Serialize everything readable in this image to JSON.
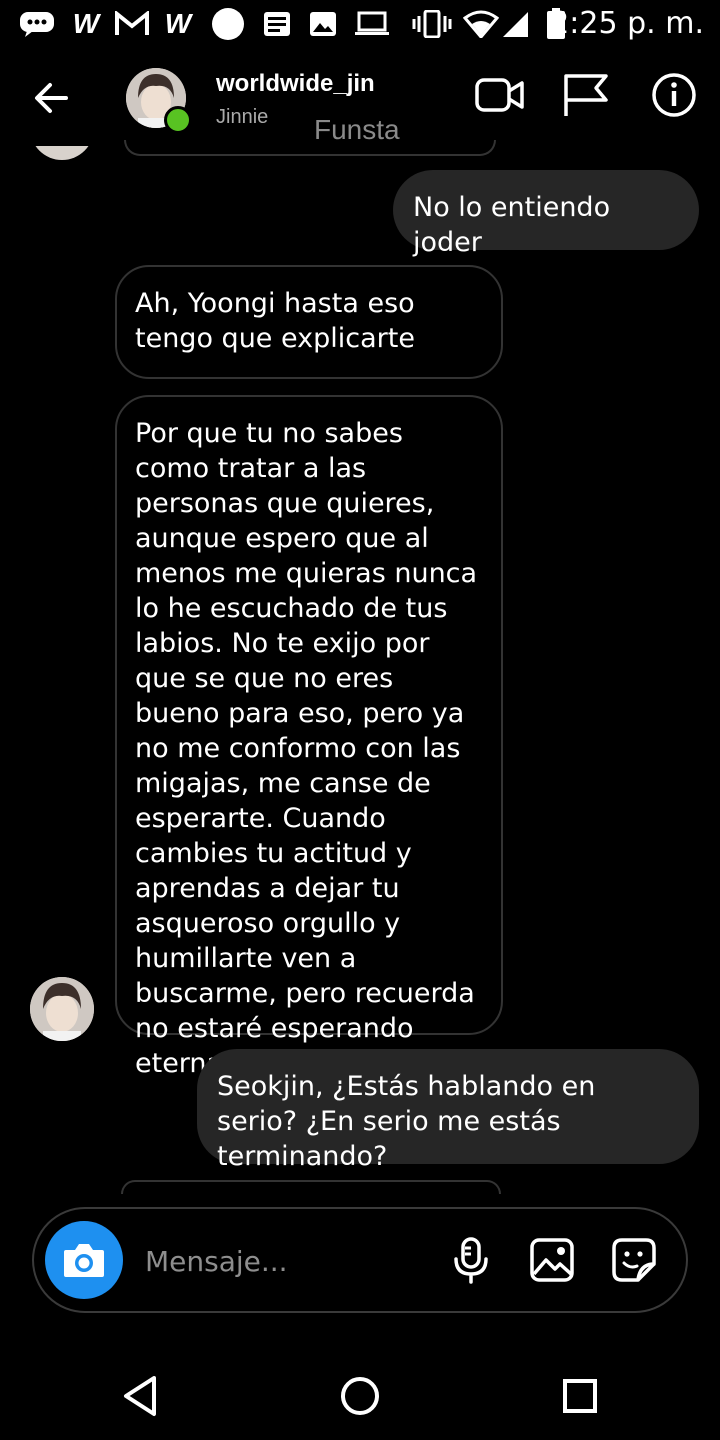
{
  "status_bar": {
    "time": "2:25 p. m.",
    "icons": [
      "messages-icon",
      "w-icon",
      "gmail-icon",
      "w-icon",
      "circle-icon",
      "news-icon",
      "gallery-icon",
      "laptop-icon",
      "vibrate-icon",
      "wifi-icon",
      "signal-icon",
      "battery-icon"
    ]
  },
  "header": {
    "username": "worldwide_jin",
    "display_name": "Jinnie",
    "overlay_text": "Funsta",
    "icons": [
      "back-arrow-icon",
      "video-call-icon",
      "flag-icon",
      "info-icon"
    ]
  },
  "messages": [
    {
      "from": "me",
      "text": "No lo entiendo joder"
    },
    {
      "from": "them",
      "text": "Ah, Yoongi hasta eso tengo que explicarte"
    },
    {
      "from": "them",
      "text": "Por que tu no sabes como tratar a las personas que quieres, aunque espero que al menos me quieras nunca lo he escuchado de tus labios. No te exijo por que se que no eres bueno para eso, pero ya no me conformo con las migajas, me canse de esperarte. Cuando cambies tu actitud y aprendas a dejar tu asqueroso orgullo y humillarte ven a buscarme, pero recuerda no estaré esperando eternamente."
    },
    {
      "from": "me",
      "text": "Seokjin, ¿Estás hablando en serio? ¿En serio me estás terminando?"
    }
  ],
  "composer": {
    "placeholder": "Mensaje...",
    "icons": [
      "camera-icon",
      "microphone-icon",
      "image-icon",
      "sticker-icon"
    ]
  },
  "nav": {
    "icons": [
      "nav-back-icon",
      "nav-home-icon",
      "nav-recents-icon"
    ]
  },
  "colors": {
    "background": "#000000",
    "outgoing_bubble": "#262626",
    "incoming_border": "#333333",
    "online": "#58c322",
    "camera_button": "#1e90f0"
  }
}
